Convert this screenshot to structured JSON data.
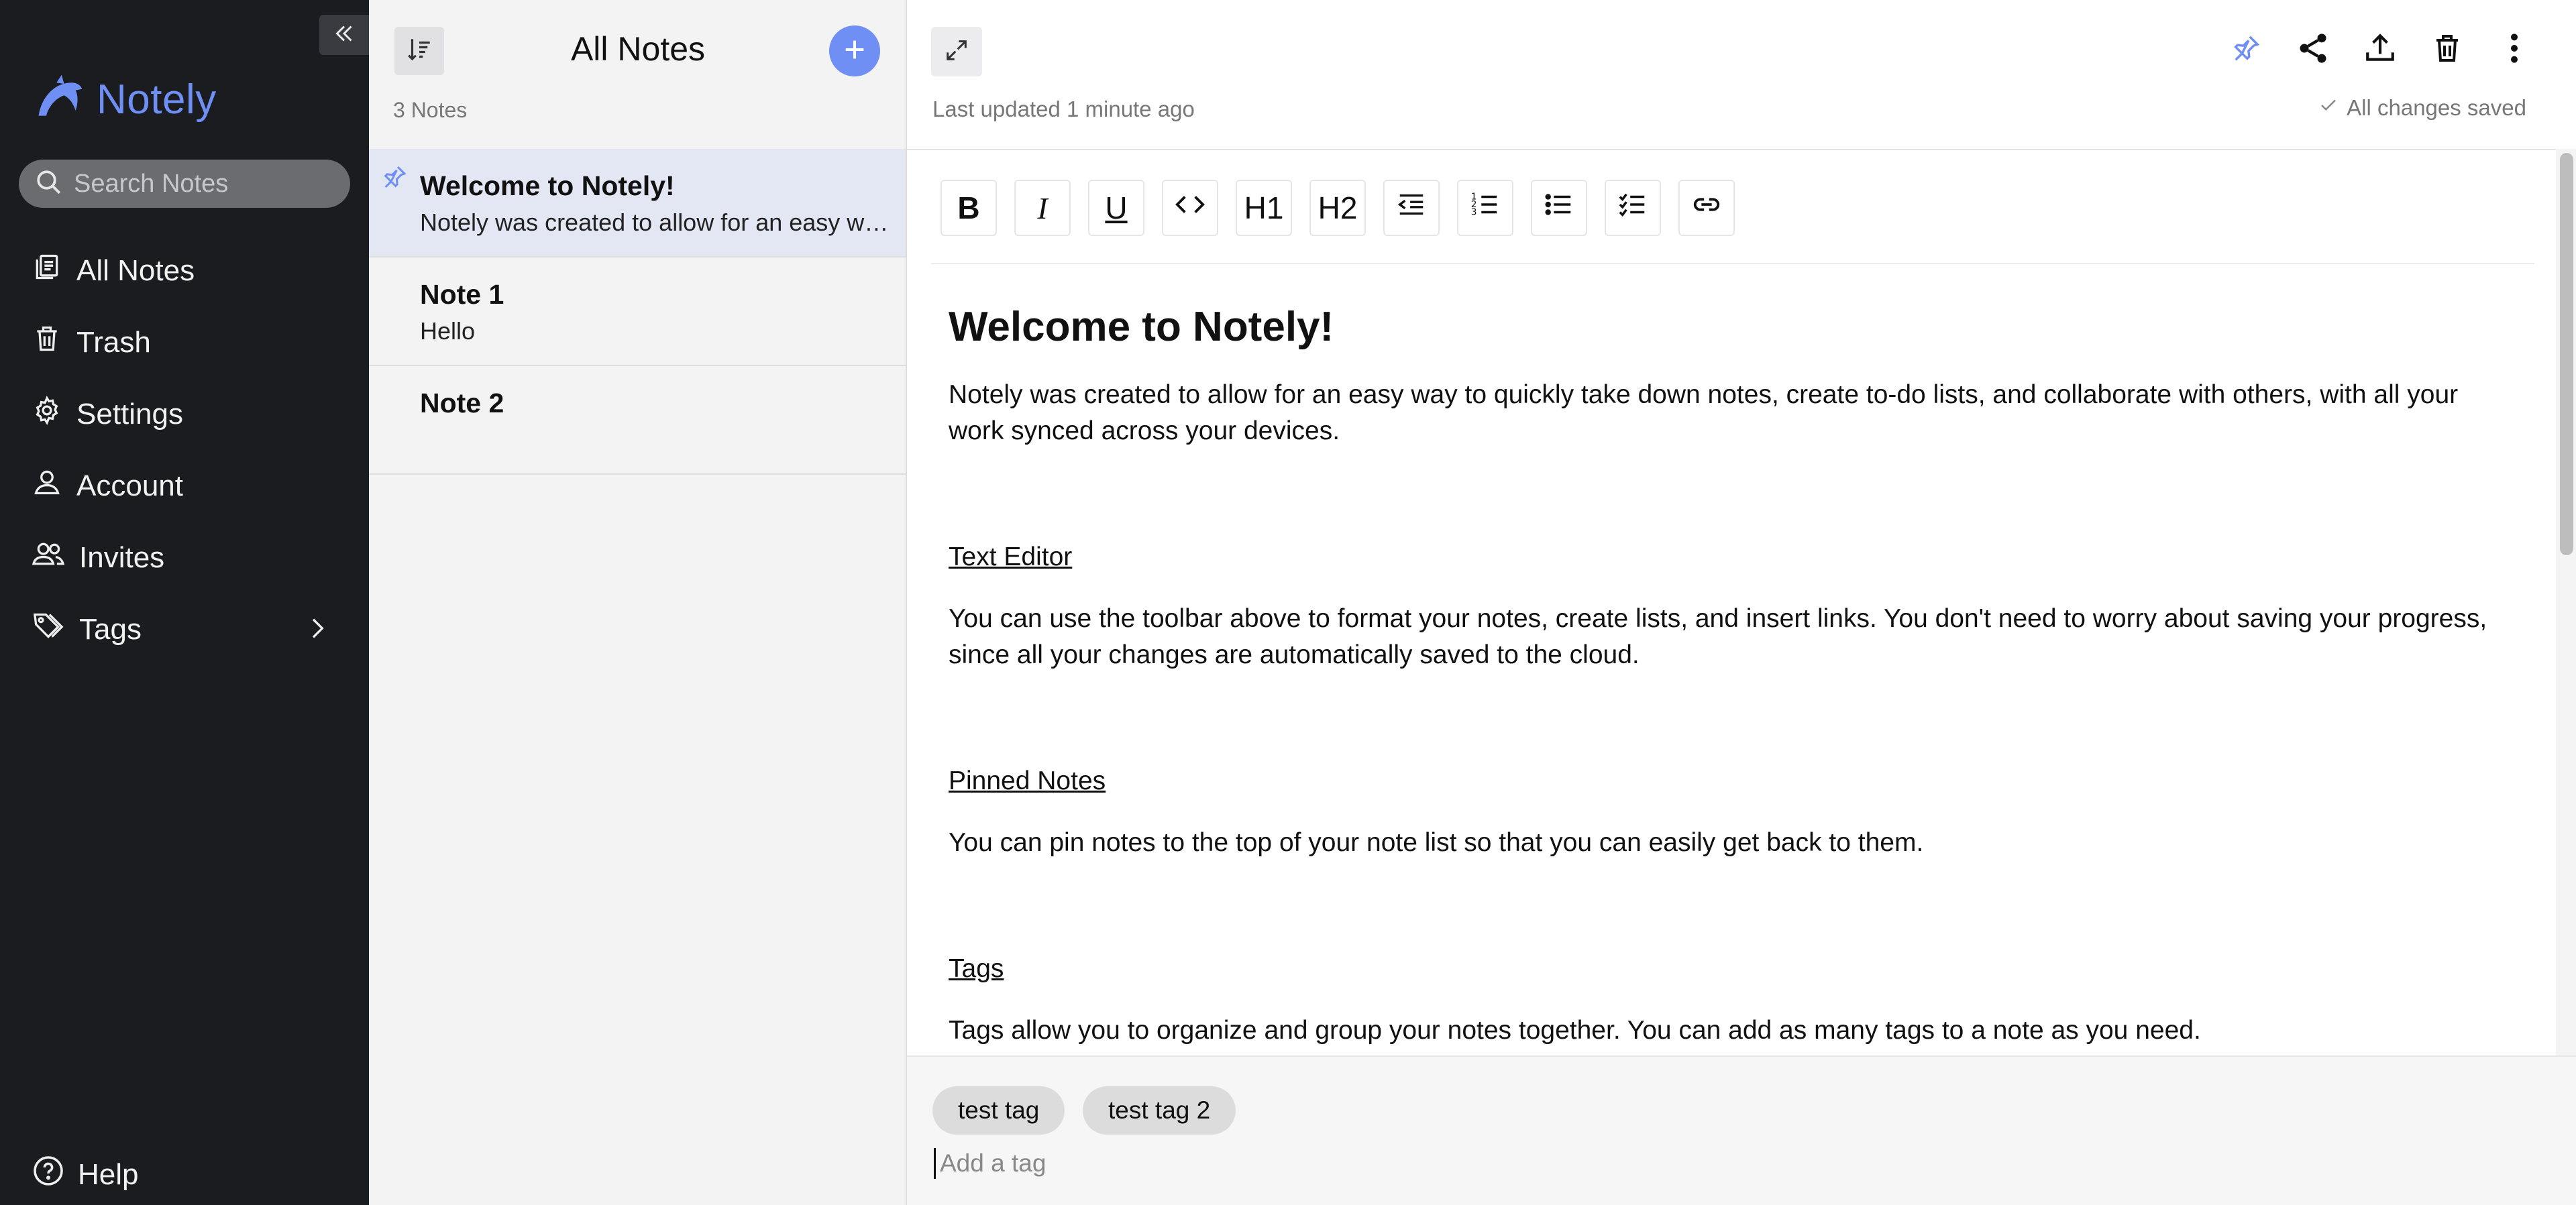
{
  "sidebar": {
    "brand": "Notely",
    "search_placeholder": "Search Notes",
    "nav": [
      {
        "label": "All Notes",
        "icon": "notes-icon"
      },
      {
        "label": "Trash",
        "icon": "trash-icon"
      },
      {
        "label": "Settings",
        "icon": "gear-icon"
      },
      {
        "label": "Account",
        "icon": "user-icon"
      },
      {
        "label": "Invites",
        "icon": "users-icon"
      },
      {
        "label": "Tags",
        "icon": "tag-icon"
      }
    ],
    "help": "Help"
  },
  "notelist": {
    "title": "All Notes",
    "count": "3 Notes",
    "notes": [
      {
        "title": "Welcome to Notely!",
        "preview": "Notely was created to allow for an easy way to quickly take down notes, create to-do lists, and collaborate with others, with all your work synced across your devices.",
        "pinned": true,
        "active": true
      },
      {
        "title": "Note 1",
        "preview": "Hello",
        "pinned": false,
        "active": false
      },
      {
        "title": "Note 2",
        "preview": "",
        "pinned": false,
        "active": false
      }
    ]
  },
  "editor": {
    "last_updated": "Last updated 1 minute ago",
    "saved_status": "All changes saved",
    "toolbar": [
      "B",
      "I",
      "U",
      "<>",
      "H1",
      "H2",
      "indent",
      "ordered-list",
      "bullet-list",
      "checklist",
      "link"
    ],
    "toolbar_text": {
      "bold": "B",
      "italic": "I",
      "underline": "U",
      "h1": "H1",
      "h2": "H2"
    },
    "content": {
      "title": "Welcome to Notely!",
      "intro": "Notely was created to allow for an easy way to quickly take down notes, create to-do lists, and collaborate with others, with all your work synced across your devices.",
      "sections": [
        {
          "heading": "Text Editor",
          "body": "You can use the toolbar above to format your notes, create lists, and insert links. You don't need to worry about saving your progress, since all your changes are automatically saved to the cloud."
        },
        {
          "heading": "Pinned Notes",
          "body": "You can pin notes to the top of your note list so that you can easily get back to them."
        },
        {
          "heading": "Tags",
          "body": "Tags allow you to organize and group your notes together. You can add as many tags to a note as you need."
        }
      ]
    },
    "tags": [
      "test tag",
      "test tag 2"
    ],
    "tag_placeholder": "Add a tag"
  },
  "colors": {
    "accent": "#6f8ff5",
    "sidebar_bg": "#1b1c20",
    "list_bg": "#f3f3f3",
    "active_note_bg": "#e3e6f3"
  }
}
